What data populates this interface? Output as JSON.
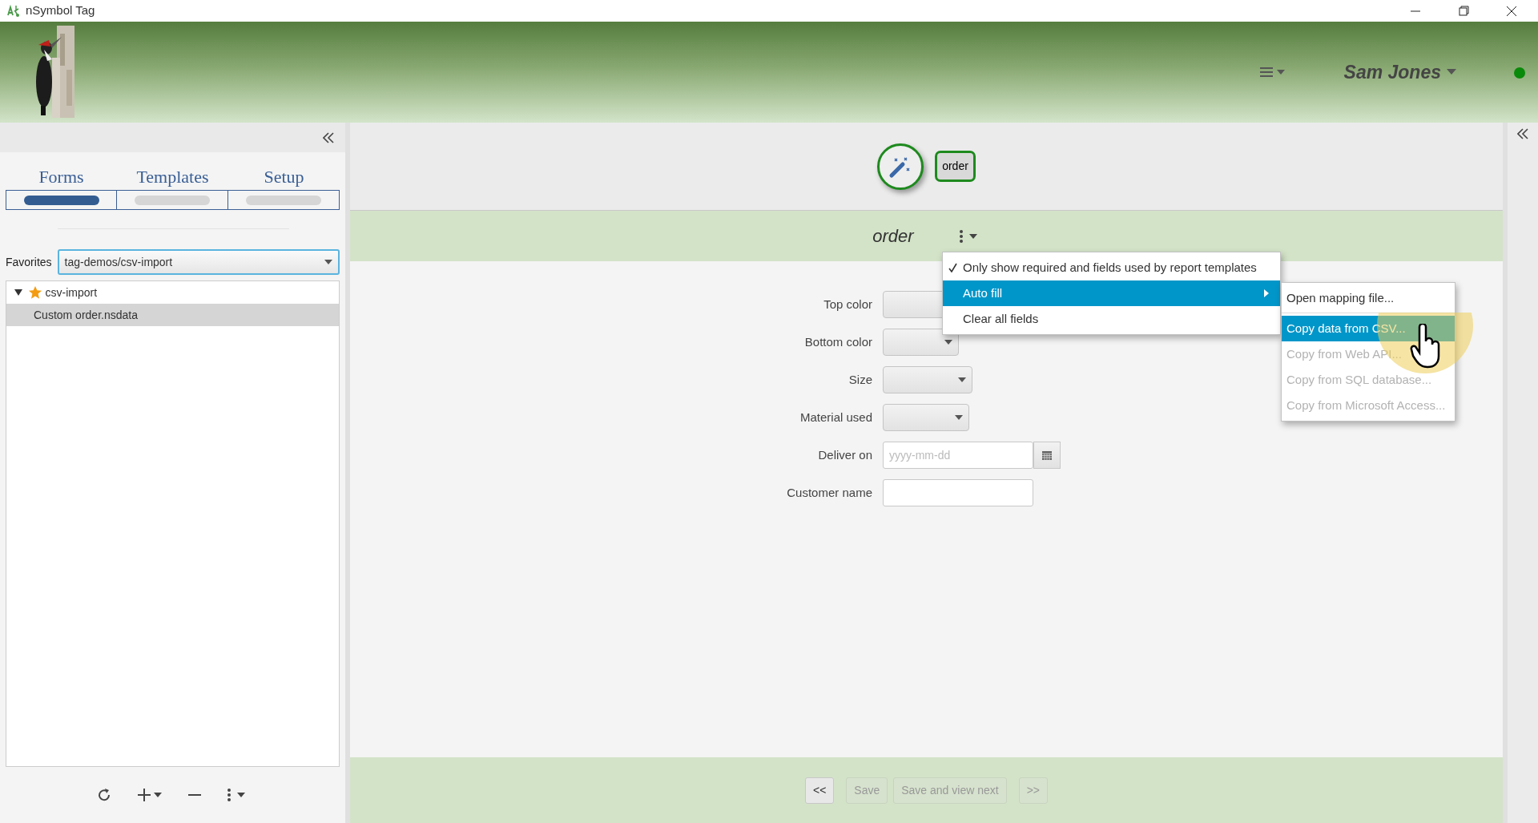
{
  "window": {
    "title": "nSymbol Tag"
  },
  "header": {
    "user": "Sam Jones",
    "online": true
  },
  "left_panel": {
    "tabs": [
      {
        "label": "Forms",
        "selected": true
      },
      {
        "label": "Templates",
        "selected": false
      },
      {
        "label": "Setup",
        "selected": false
      }
    ],
    "favorites": {
      "label": "Favorites",
      "value": "tag-demos/csv-import"
    },
    "tree": [
      {
        "label": "csv-import",
        "expanded": true,
        "starred": true,
        "selected": false,
        "children": [
          {
            "label": "Custom order.nsdata",
            "selected": true
          }
        ]
      }
    ]
  },
  "form": {
    "chip": "order",
    "title": "order",
    "fields": [
      {
        "label": "Top color",
        "kind": "combo"
      },
      {
        "label": "Bottom color",
        "kind": "combo"
      },
      {
        "label": "Size",
        "kind": "combo"
      },
      {
        "label": "Material used",
        "kind": "combo"
      },
      {
        "label": "Deliver on",
        "kind": "date",
        "placeholder": "yyyy-mm-dd"
      },
      {
        "label": "Customer name",
        "kind": "text"
      }
    ],
    "menu": [
      {
        "label": "Only show required and fields used by report templates",
        "kind": "item",
        "checked": true,
        "selected": false
      },
      {
        "label": "Auto fill",
        "kind": "submenu",
        "checked": false,
        "selected": true
      },
      {
        "label": "Clear all fields",
        "kind": "item",
        "checked": false,
        "selected": false
      }
    ],
    "submenu": [
      {
        "label": "Open mapping file...",
        "selected": false,
        "disabled": false
      },
      {
        "label": "Copy data from CSV...",
        "selected": true,
        "disabled": false
      },
      {
        "label": "Copy from Web API...",
        "selected": false,
        "disabled": true
      },
      {
        "label": "Copy from SQL database...",
        "selected": false,
        "disabled": true
      },
      {
        "label": "Copy from Microsoft Access...",
        "selected": false,
        "disabled": true
      }
    ],
    "buttons": [
      {
        "label": "<<",
        "disabled": false
      },
      {
        "label": "Save",
        "disabled": true
      },
      {
        "label": "Save and view next",
        "disabled": true
      },
      {
        "label": ">>",
        "disabled": true
      }
    ]
  }
}
